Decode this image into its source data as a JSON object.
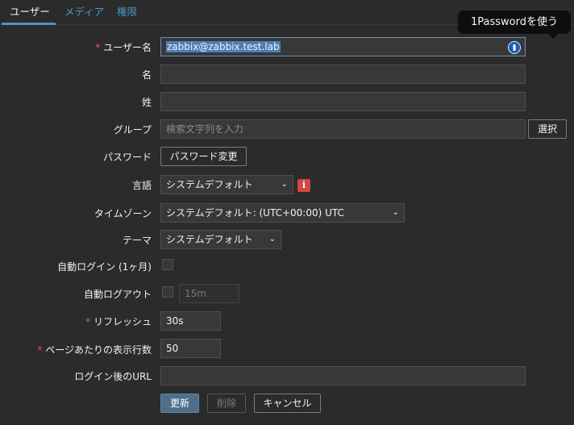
{
  "tabs": [
    {
      "label": "ユーザー"
    },
    {
      "label": "メディア"
    },
    {
      "label": "権限"
    }
  ],
  "tooltip": "1Passwordを使う",
  "form": {
    "username": {
      "label": "ユーザー名",
      "required_mark": "*",
      "value": "zabbix@zabbix.test.lab"
    },
    "first_name": {
      "label": "名",
      "value": ""
    },
    "last_name": {
      "label": "姓",
      "value": ""
    },
    "groups": {
      "label": "グループ",
      "placeholder": "検索文字列を入力",
      "select_button": "選択"
    },
    "password": {
      "label": "パスワード",
      "button": "パスワード変更"
    },
    "language": {
      "label": "言語",
      "value": "システムデフォルト",
      "info_badge": "i"
    },
    "timezone": {
      "label": "タイムゾーン",
      "value": "システムデフォルト: (UTC+00:00) UTC"
    },
    "theme": {
      "label": "テーマ",
      "value": "システムデフォルト"
    },
    "autologin": {
      "label": "自動ログイン (1ヶ月)",
      "checked": false
    },
    "autologout": {
      "label": "自動ログアウト",
      "checked": false,
      "value": "15m"
    },
    "refresh": {
      "label": "リフレッシュ",
      "required_mark": "*",
      "value": "30s"
    },
    "rows_per_page": {
      "label": "ページあたりの表示行数",
      "required_mark": "*",
      "value": "50"
    },
    "url_after_login": {
      "label": "ログイン後のURL",
      "value": ""
    }
  },
  "actions": {
    "update": "更新",
    "delete": "削除",
    "cancel": "キャンセル"
  },
  "colors": {
    "background": "#2b2b2b",
    "accent": "#4796c4",
    "required": "#e45959",
    "info_badge": "#d64545",
    "primary_button": "#4f6e8a"
  },
  "icons": {
    "password_manager": "1password-icon",
    "dropdown": "chevron-down-icon",
    "info": "info-icon"
  }
}
